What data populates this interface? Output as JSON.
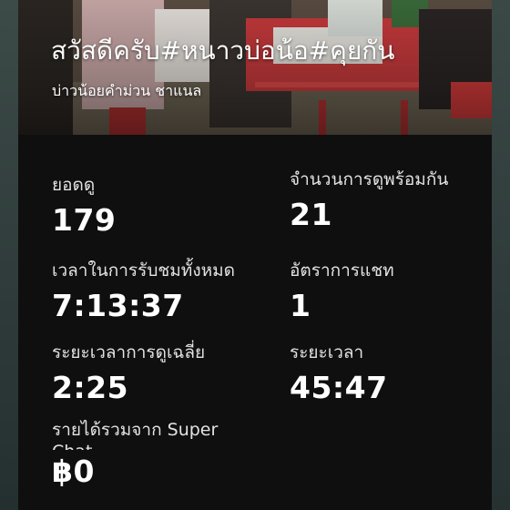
{
  "video": {
    "title": "สวัสดีครับ#หนาวบ่อน้อ#คุยกัน",
    "channel": "บ่าวน้อยคำม่วน ชาแนล"
  },
  "stats": [
    {
      "label": "ยอดดู",
      "value": "179"
    },
    {
      "label": "จำนวนการดูพร้อมกัน",
      "value": "21"
    },
    {
      "label": "เวลาในการรับชมทั้งหมด",
      "value": "7:13:37"
    },
    {
      "label": "อัตราการแชท",
      "value": "1"
    },
    {
      "label": "ระยะเวลาการดูเฉลี่ย",
      "value": "2:25"
    },
    {
      "label": "ระยะเวลา",
      "value": "45:47"
    },
    {
      "label": "รายได้รวมจาก Super Chat",
      "value": "฿0"
    }
  ],
  "colors": {
    "panel_bg": "#0f0f0f",
    "text": "#ffffff",
    "label": "#e2e2e2"
  }
}
